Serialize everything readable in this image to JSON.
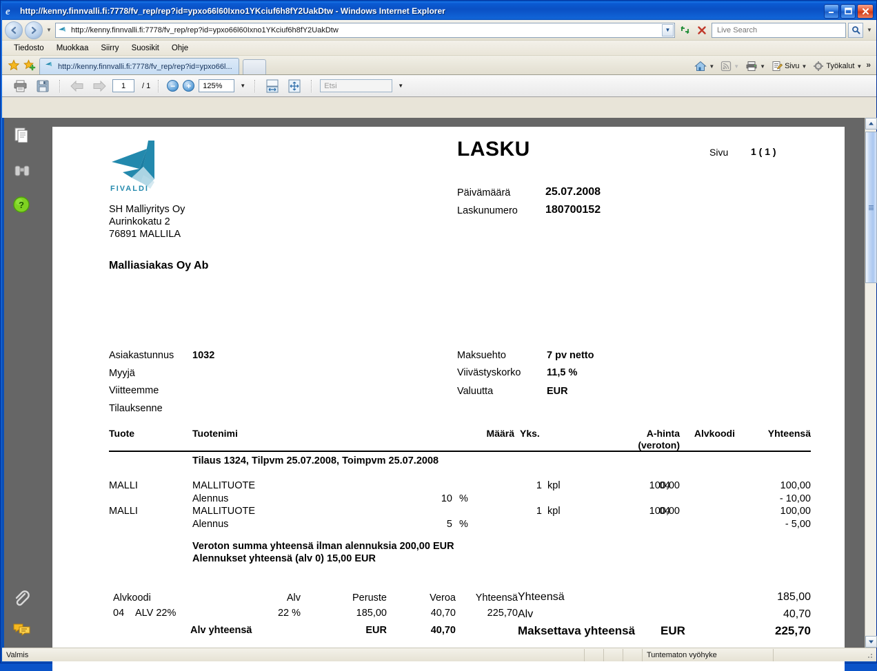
{
  "window": {
    "title": "http://kenny.finnvalli.fi:7778/fv_rep/rep?id=ypxo66l60Ixno1YKciuf6h8fY2UakDtw - Windows Internet Explorer",
    "minimize": "_",
    "maximize": "□",
    "close": "✕"
  },
  "browser": {
    "url": "http://kenny.finnvalli.fi:7778/fv_rep/rep?id=ypxo66l60Ixno1YKciuf6h8fY2UakDtw",
    "search_placeholder": "Live Search",
    "menu": [
      "Tiedosto",
      "Muokkaa",
      "Siirry",
      "Suosikit",
      "Ohje"
    ],
    "tab_label": "http://kenny.finnvalli.fi:7778/fv_rep/rep?id=ypxo66l...",
    "commands": [
      {
        "label": "Sivu",
        "icon": "page-icon"
      },
      {
        "label": "Työkalut",
        "icon": "gear-icon"
      }
    ],
    "overflow": "»"
  },
  "pdf_toolbar": {
    "page_current": "1",
    "page_total": "/ 1",
    "zoom": "125%",
    "find_placeholder": "Etsi"
  },
  "status": {
    "left": "Valmis",
    "zone": "Tuntematon vyöhyke"
  },
  "invoice": {
    "logo_text": "FIVALDI",
    "title": "LASKU",
    "page_label": "Sivu",
    "page_value": "1  ( 1 )",
    "sender": [
      "SH Malliyritys Oy",
      "Aurinkokatu 2",
      "76891 MALLILA"
    ],
    "recipient": "Malliasiakas Oy Ab",
    "meta_left": [
      {
        "label": "Päivämäärä",
        "value": "25.07.2008"
      },
      {
        "label": "Laskunumero",
        "value": "180700152"
      }
    ],
    "fields_left": [
      {
        "label": "Asiakastunnus",
        "value": "1032"
      },
      {
        "label": "Myyjä",
        "value": ""
      },
      {
        "label": "Viitteemme",
        "value": ""
      },
      {
        "label": "Tilauksenne",
        "value": ""
      }
    ],
    "fields_right": [
      {
        "label": "Maksuehto",
        "value": "7 pv netto"
      },
      {
        "label": "Viivästyskorko",
        "value": "11,5 %"
      },
      {
        "label": "Valuutta",
        "value": "EUR"
      }
    ],
    "table_headers": {
      "product": "Tuote",
      "name": "Tuotenimi",
      "qty": "Määrä",
      "unit": "Yks.",
      "price": "A-hinta",
      "price_sub": "(veroton)",
      "vatcode": "Alvkoodi",
      "total": "Yhteensä"
    },
    "order_line": "Tilaus 1324, Tilpvm 25.07.2008, Toimpvm 25.07.2008",
    "rows": [
      {
        "product": "MALLI",
        "name": "MALLITUOTE",
        "qty": "1",
        "unit": "kpl",
        "price": "100,00",
        "vatcode": "04",
        "total": "100,00"
      },
      {
        "product": "",
        "name": "Alennus",
        "pct": "10",
        "pct_sym": "%",
        "qty": "",
        "unit": "",
        "price": "",
        "vatcode": "",
        "total": "- 10,00"
      },
      {
        "product": "MALLI",
        "name": "MALLITUOTE",
        "qty": "1",
        "unit": "kpl",
        "price": "100,00",
        "vatcode": "04",
        "total": "100,00"
      },
      {
        "product": "",
        "name": "Alennus",
        "pct": "5",
        "pct_sym": "%",
        "qty": "",
        "unit": "",
        "price": "",
        "vatcode": "",
        "total": "- 5,00"
      }
    ],
    "summary_lines": [
      "Veroton summa yhteensä ilman alennuksia 200,00 EUR",
      "Alennukset yhteensä (alv 0) 15,00 EUR"
    ],
    "vat_table": {
      "headers": [
        "Alvkoodi",
        "Alv",
        "Peruste",
        "Veroa",
        "Yhteensä"
      ],
      "row": {
        "code": "04",
        "name": "ALV 22%",
        "rate": "22 %",
        "base": "185,00",
        "tax": "40,70",
        "total": "225,70"
      },
      "footer": {
        "label": "Alv yhteensä",
        "currency": "EUR",
        "amount": "40,70"
      }
    },
    "totals": [
      {
        "label": "Yhteensä",
        "currency": "",
        "value": "185,00",
        "bold": false
      },
      {
        "label": "Alv",
        "currency": "",
        "value": "40,70",
        "bold": false
      },
      {
        "label": "Maksettava yhteensä",
        "currency": "EUR",
        "value": "225,70",
        "bold": true
      }
    ]
  },
  "colors": {
    "brand_teal": "#2389ad",
    "title_blue": "#0a50c4",
    "viewer_gray": "#666666"
  }
}
